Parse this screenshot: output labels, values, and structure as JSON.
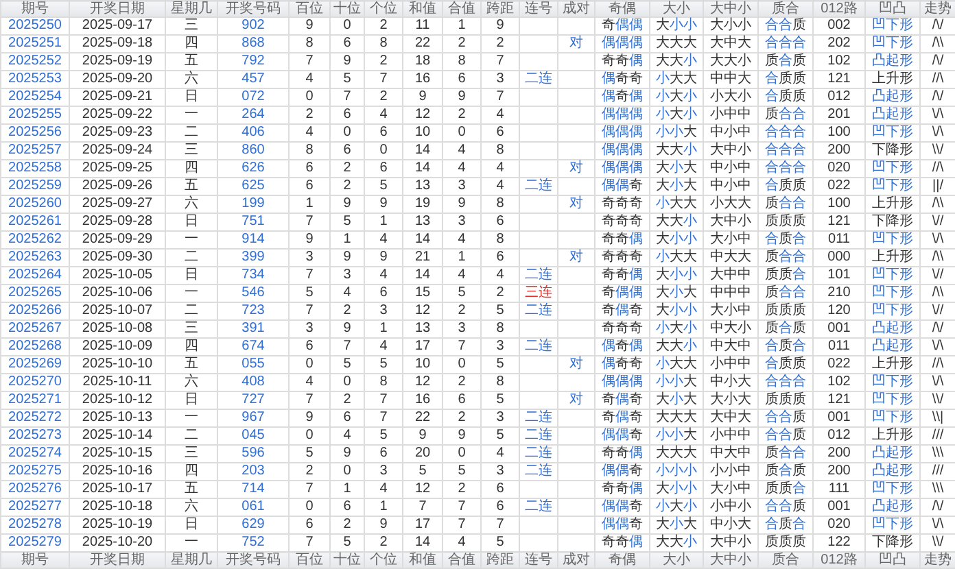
{
  "header": [
    "期号",
    "开奖日期",
    "星期几",
    "开奖号码",
    "百位",
    "十位",
    "个位",
    "和值",
    "合值",
    "跨距",
    "连号",
    "成对",
    "奇偶",
    "大小",
    "大中小",
    "质合",
    "012路",
    "凹凸",
    "走势"
  ],
  "rows": [
    {
      "issue": "2025250",
      "date": "2025-09-17",
      "weekday": "三",
      "number": "902",
      "hundreds": "9",
      "tens": "0",
      "units": "2",
      "sum": "11",
      "sum_tail": "1",
      "span": "9",
      "parity": {
        "text": "奇偶偶",
        "marked": [
          false,
          true,
          true
        ]
      },
      "size": {
        "text": "大小小",
        "marked": [
          false,
          true,
          true
        ]
      },
      "band": "大小小",
      "prime": {
        "text": "合合质",
        "marked": [
          true,
          true,
          false
        ]
      },
      "route": "002",
      "shape": {
        "text": "凹下形",
        "marked": true
      },
      "trend": "/\\/"
    },
    {
      "issue": "2025251",
      "date": "2025-09-18",
      "weekday": "四",
      "number": "868",
      "hundreds": "8",
      "tens": "6",
      "units": "8",
      "sum": "22",
      "sum_tail": "2",
      "span": "2",
      "pair": "对",
      "parity": {
        "text": "偶偶偶",
        "marked": [
          true,
          true,
          true
        ]
      },
      "size": {
        "text": "大大大",
        "marked": [
          false,
          false,
          false
        ]
      },
      "band": "大中大",
      "prime": {
        "text": "合合合",
        "marked": [
          true,
          true,
          true
        ]
      },
      "route": "202",
      "shape": {
        "text": "凹下形",
        "marked": true
      },
      "trend": "/\\\\"
    },
    {
      "issue": "2025252",
      "date": "2025-09-19",
      "weekday": "五",
      "number": "792",
      "hundreds": "7",
      "tens": "9",
      "units": "2",
      "sum": "18",
      "sum_tail": "8",
      "span": "7",
      "parity": {
        "text": "奇奇偶",
        "marked": [
          false,
          false,
          true
        ]
      },
      "size": {
        "text": "大大小",
        "marked": [
          false,
          false,
          true
        ]
      },
      "band": "大大小",
      "prime": {
        "text": "质合质",
        "marked": [
          false,
          true,
          false
        ]
      },
      "route": "102",
      "shape": {
        "text": "凸起形",
        "marked": true
      },
      "trend": "/\\/"
    },
    {
      "issue": "2025253",
      "date": "2025-09-20",
      "weekday": "六",
      "number": "457",
      "hundreds": "4",
      "tens": "5",
      "units": "7",
      "sum": "16",
      "sum_tail": "6",
      "span": "3",
      "consec": {
        "text": "二连",
        "color": "#2f6fd6"
      },
      "parity": {
        "text": "偶奇奇",
        "marked": [
          true,
          false,
          false
        ]
      },
      "size": {
        "text": "小大大",
        "marked": [
          true,
          false,
          false
        ]
      },
      "band": "中中大",
      "prime": {
        "text": "合质质",
        "marked": [
          true,
          false,
          false
        ]
      },
      "route": "121",
      "shape": {
        "text": "上升形",
        "marked": false
      },
      "trend": "//\\"
    },
    {
      "issue": "2025254",
      "date": "2025-09-21",
      "weekday": "日",
      "number": "072",
      "hundreds": "0",
      "tens": "7",
      "units": "2",
      "sum": "9",
      "sum_tail": "9",
      "span": "7",
      "parity": {
        "text": "偶奇偶",
        "marked": [
          true,
          false,
          true
        ]
      },
      "size": {
        "text": "小大小",
        "marked": [
          true,
          false,
          true
        ]
      },
      "band": "小大小",
      "prime": {
        "text": "合质质",
        "marked": [
          true,
          false,
          false
        ]
      },
      "route": "012",
      "shape": {
        "text": "凸起形",
        "marked": true
      },
      "trend": "/\\/"
    },
    {
      "issue": "2025255",
      "date": "2025-09-22",
      "weekday": "一",
      "number": "264",
      "hundreds": "2",
      "tens": "6",
      "units": "4",
      "sum": "12",
      "sum_tail": "2",
      "span": "4",
      "parity": {
        "text": "偶偶偶",
        "marked": [
          true,
          true,
          true
        ]
      },
      "size": {
        "text": "小大小",
        "marked": [
          true,
          false,
          true
        ]
      },
      "band": "小中中",
      "prime": {
        "text": "质合合",
        "marked": [
          false,
          true,
          true
        ]
      },
      "route": "201",
      "shape": {
        "text": "凸起形",
        "marked": true
      },
      "trend": "\\/\\"
    },
    {
      "issue": "2025256",
      "date": "2025-09-23",
      "weekday": "二",
      "number": "406",
      "hundreds": "4",
      "tens": "0",
      "units": "6",
      "sum": "10",
      "sum_tail": "0",
      "span": "6",
      "parity": {
        "text": "偶偶偶",
        "marked": [
          true,
          true,
          true
        ]
      },
      "size": {
        "text": "小小大",
        "marked": [
          true,
          true,
          false
        ]
      },
      "band": "中小中",
      "prime": {
        "text": "合合合",
        "marked": [
          true,
          true,
          true
        ]
      },
      "route": "100",
      "shape": {
        "text": "凹下形",
        "marked": true
      },
      "trend": "\\/\\"
    },
    {
      "issue": "2025257",
      "date": "2025-09-24",
      "weekday": "三",
      "number": "860",
      "hundreds": "8",
      "tens": "6",
      "units": "0",
      "sum": "14",
      "sum_tail": "4",
      "span": "8",
      "parity": {
        "text": "偶偶偶",
        "marked": [
          true,
          true,
          true
        ]
      },
      "size": {
        "text": "大大小",
        "marked": [
          false,
          false,
          true
        ]
      },
      "band": "大中小",
      "prime": {
        "text": "合合合",
        "marked": [
          true,
          true,
          true
        ]
      },
      "route": "200",
      "shape": {
        "text": "下降形",
        "marked": false
      },
      "trend": "\\\\/"
    },
    {
      "issue": "2025258",
      "date": "2025-09-25",
      "weekday": "四",
      "number": "626",
      "hundreds": "6",
      "tens": "2",
      "units": "6",
      "sum": "14",
      "sum_tail": "4",
      "span": "4",
      "pair": "对",
      "parity": {
        "text": "偶偶偶",
        "marked": [
          true,
          true,
          true
        ]
      },
      "size": {
        "text": "大小大",
        "marked": [
          false,
          true,
          false
        ]
      },
      "band": "中小中",
      "prime": {
        "text": "合合合",
        "marked": [
          true,
          true,
          true
        ]
      },
      "route": "020",
      "shape": {
        "text": "凹下形",
        "marked": true
      },
      "trend": "//\\"
    },
    {
      "issue": "2025259",
      "date": "2025-09-26",
      "weekday": "五",
      "number": "625",
      "hundreds": "6",
      "tens": "2",
      "units": "5",
      "sum": "13",
      "sum_tail": "3",
      "span": "4",
      "consec": {
        "text": "二连",
        "color": "#2f6fd6"
      },
      "parity": {
        "text": "偶偶奇",
        "marked": [
          true,
          true,
          false
        ]
      },
      "size": {
        "text": "大小大",
        "marked": [
          false,
          true,
          false
        ]
      },
      "band": "中小中",
      "prime": {
        "text": "合质质",
        "marked": [
          true,
          false,
          false
        ]
      },
      "route": "022",
      "shape": {
        "text": "凹下形",
        "marked": true
      },
      "trend": "||/"
    },
    {
      "issue": "2025260",
      "date": "2025-09-27",
      "weekday": "六",
      "number": "199",
      "hundreds": "1",
      "tens": "9",
      "units": "9",
      "sum": "19",
      "sum_tail": "9",
      "span": "8",
      "pair": "对",
      "parity": {
        "text": "奇奇奇",
        "marked": [
          false,
          false,
          false
        ]
      },
      "size": {
        "text": "小大大",
        "marked": [
          true,
          false,
          false
        ]
      },
      "band": "小大大",
      "prime": {
        "text": "质合合",
        "marked": [
          false,
          true,
          true
        ]
      },
      "route": "100",
      "shape": {
        "text": "上升形",
        "marked": false
      },
      "trend": "/\\\\"
    },
    {
      "issue": "2025261",
      "date": "2025-09-28",
      "weekday": "日",
      "number": "751",
      "hundreds": "7",
      "tens": "5",
      "units": "1",
      "sum": "13",
      "sum_tail": "3",
      "span": "6",
      "parity": {
        "text": "奇奇奇",
        "marked": [
          false,
          false,
          false
        ]
      },
      "size": {
        "text": "大大小",
        "marked": [
          false,
          false,
          true
        ]
      },
      "band": "大中小",
      "prime": {
        "text": "质质质",
        "marked": [
          false,
          false,
          false
        ]
      },
      "route": "121",
      "shape": {
        "text": "下降形",
        "marked": false
      },
      "trend": "\\//"
    },
    {
      "issue": "2025262",
      "date": "2025-09-29",
      "weekday": "一",
      "number": "914",
      "hundreds": "9",
      "tens": "1",
      "units": "4",
      "sum": "14",
      "sum_tail": "4",
      "span": "8",
      "parity": {
        "text": "奇奇偶",
        "marked": [
          false,
          false,
          true
        ]
      },
      "size": {
        "text": "大小小",
        "marked": [
          false,
          true,
          true
        ]
      },
      "band": "大小中",
      "prime": {
        "text": "合质合",
        "marked": [
          true,
          false,
          true
        ]
      },
      "route": "011",
      "shape": {
        "text": "凹下形",
        "marked": true
      },
      "trend": "\\/\\"
    },
    {
      "issue": "2025263",
      "date": "2025-09-30",
      "weekday": "二",
      "number": "399",
      "hundreds": "3",
      "tens": "9",
      "units": "9",
      "sum": "21",
      "sum_tail": "1",
      "span": "6",
      "pair": "对",
      "parity": {
        "text": "奇奇奇",
        "marked": [
          false,
          false,
          false
        ]
      },
      "size": {
        "text": "小大大",
        "marked": [
          true,
          false,
          false
        ]
      },
      "band": "中大大",
      "prime": {
        "text": "质合合",
        "marked": [
          false,
          true,
          true
        ]
      },
      "route": "000",
      "shape": {
        "text": "上升形",
        "marked": false
      },
      "trend": "/\\\\"
    },
    {
      "issue": "2025264",
      "date": "2025-10-05",
      "weekday": "日",
      "number": "734",
      "hundreds": "7",
      "tens": "3",
      "units": "4",
      "sum": "14",
      "sum_tail": "4",
      "span": "4",
      "consec": {
        "text": "二连",
        "color": "#2f6fd6"
      },
      "parity": {
        "text": "奇奇偶",
        "marked": [
          false,
          false,
          true
        ]
      },
      "size": {
        "text": "大小小",
        "marked": [
          false,
          true,
          true
        ]
      },
      "band": "大中中",
      "prime": {
        "text": "质质合",
        "marked": [
          false,
          false,
          true
        ]
      },
      "route": "101",
      "shape": {
        "text": "凹下形",
        "marked": true
      },
      "trend": "\\//"
    },
    {
      "issue": "2025265",
      "date": "2025-10-06",
      "weekday": "一",
      "number": "546",
      "hundreds": "5",
      "tens": "4",
      "units": "6",
      "sum": "15",
      "sum_tail": "5",
      "span": "2",
      "consec": {
        "text": "三连",
        "color": "#e0302a"
      },
      "parity": {
        "text": "奇偶偶",
        "marked": [
          false,
          true,
          true
        ]
      },
      "size": {
        "text": "大小大",
        "marked": [
          false,
          true,
          false
        ]
      },
      "band": "中中中",
      "prime": {
        "text": "质合合",
        "marked": [
          false,
          true,
          true
        ]
      },
      "route": "210",
      "shape": {
        "text": "凹下形",
        "marked": true
      },
      "trend": "/\\\\"
    },
    {
      "issue": "2025266",
      "date": "2025-10-07",
      "weekday": "二",
      "number": "723",
      "hundreds": "7",
      "tens": "2",
      "units": "3",
      "sum": "12",
      "sum_tail": "2",
      "span": "5",
      "consec": {
        "text": "二连",
        "color": "#2f6fd6"
      },
      "parity": {
        "text": "奇偶奇",
        "marked": [
          false,
          true,
          false
        ]
      },
      "size": {
        "text": "大小小",
        "marked": [
          false,
          true,
          true
        ]
      },
      "band": "大小中",
      "prime": {
        "text": "质质质",
        "marked": [
          false,
          false,
          false
        ]
      },
      "route": "120",
      "shape": {
        "text": "凹下形",
        "marked": true
      },
      "trend": "\\//"
    },
    {
      "issue": "2025267",
      "date": "2025-10-08",
      "weekday": "三",
      "number": "391",
      "hundreds": "3",
      "tens": "9",
      "units": "1",
      "sum": "13",
      "sum_tail": "3",
      "span": "8",
      "parity": {
        "text": "奇奇奇",
        "marked": [
          false,
          false,
          false
        ]
      },
      "size": {
        "text": "小大小",
        "marked": [
          true,
          false,
          true
        ]
      },
      "band": "中大小",
      "prime": {
        "text": "质合质",
        "marked": [
          false,
          true,
          false
        ]
      },
      "route": "001",
      "shape": {
        "text": "凸起形",
        "marked": true
      },
      "trend": "/\\/"
    },
    {
      "issue": "2025268",
      "date": "2025-10-09",
      "weekday": "四",
      "number": "674",
      "hundreds": "6",
      "tens": "7",
      "units": "4",
      "sum": "17",
      "sum_tail": "7",
      "span": "3",
      "consec": {
        "text": "二连",
        "color": "#2f6fd6"
      },
      "parity": {
        "text": "偶奇偶",
        "marked": [
          true,
          false,
          true
        ]
      },
      "size": {
        "text": "大大小",
        "marked": [
          false,
          false,
          true
        ]
      },
      "band": "中大中",
      "prime": {
        "text": "合质合",
        "marked": [
          true,
          false,
          true
        ]
      },
      "route": "011",
      "shape": {
        "text": "凸起形",
        "marked": true
      },
      "trend": "\\/\\"
    },
    {
      "issue": "2025269",
      "date": "2025-10-10",
      "weekday": "五",
      "number": "055",
      "hundreds": "0",
      "tens": "5",
      "units": "5",
      "sum": "10",
      "sum_tail": "0",
      "span": "5",
      "pair": "对",
      "parity": {
        "text": "偶奇奇",
        "marked": [
          true,
          false,
          false
        ]
      },
      "size": {
        "text": "小大大",
        "marked": [
          true,
          false,
          false
        ]
      },
      "band": "小中中",
      "prime": {
        "text": "合质质",
        "marked": [
          true,
          false,
          false
        ]
      },
      "route": "022",
      "shape": {
        "text": "上升形",
        "marked": false
      },
      "trend": "//\\"
    },
    {
      "issue": "2025270",
      "date": "2025-10-11",
      "weekday": "六",
      "number": "408",
      "hundreds": "4",
      "tens": "0",
      "units": "8",
      "sum": "12",
      "sum_tail": "2",
      "span": "8",
      "parity": {
        "text": "偶偶偶",
        "marked": [
          true,
          true,
          true
        ]
      },
      "size": {
        "text": "小小大",
        "marked": [
          true,
          true,
          false
        ]
      },
      "band": "中小大",
      "prime": {
        "text": "合合合",
        "marked": [
          true,
          true,
          true
        ]
      },
      "route": "102",
      "shape": {
        "text": "凹下形",
        "marked": true
      },
      "trend": "\\/\\"
    },
    {
      "issue": "2025271",
      "date": "2025-10-12",
      "weekday": "日",
      "number": "727",
      "hundreds": "7",
      "tens": "2",
      "units": "7",
      "sum": "16",
      "sum_tail": "6",
      "span": "5",
      "pair": "对",
      "parity": {
        "text": "奇偶奇",
        "marked": [
          false,
          true,
          false
        ]
      },
      "size": {
        "text": "大小大",
        "marked": [
          false,
          true,
          false
        ]
      },
      "band": "大小大",
      "prime": {
        "text": "质质质",
        "marked": [
          false,
          false,
          false
        ]
      },
      "route": "121",
      "shape": {
        "text": "凹下形",
        "marked": true
      },
      "trend": "\\\\/"
    },
    {
      "issue": "2025272",
      "date": "2025-10-13",
      "weekday": "一",
      "number": "967",
      "hundreds": "9",
      "tens": "6",
      "units": "7",
      "sum": "22",
      "sum_tail": "2",
      "span": "3",
      "consec": {
        "text": "二连",
        "color": "#2f6fd6"
      },
      "parity": {
        "text": "奇偶奇",
        "marked": [
          false,
          true,
          false
        ]
      },
      "size": {
        "text": "大大大",
        "marked": [
          false,
          false,
          false
        ]
      },
      "band": "大中大",
      "prime": {
        "text": "合合质",
        "marked": [
          true,
          true,
          false
        ]
      },
      "route": "001",
      "shape": {
        "text": "凹下形",
        "marked": true
      },
      "trend": "\\\\|"
    },
    {
      "issue": "2025273",
      "date": "2025-10-14",
      "weekday": "二",
      "number": "045",
      "hundreds": "0",
      "tens": "4",
      "units": "5",
      "sum": "9",
      "sum_tail": "9",
      "span": "5",
      "consec": {
        "text": "二连",
        "color": "#2f6fd6"
      },
      "parity": {
        "text": "偶偶奇",
        "marked": [
          true,
          true,
          false
        ]
      },
      "size": {
        "text": "小小大",
        "marked": [
          true,
          true,
          false
        ]
      },
      "band": "小中中",
      "prime": {
        "text": "合合质",
        "marked": [
          true,
          true,
          false
        ]
      },
      "route": "012",
      "shape": {
        "text": "上升形",
        "marked": false
      },
      "trend": "///"
    },
    {
      "issue": "2025274",
      "date": "2025-10-15",
      "weekday": "三",
      "number": "596",
      "hundreds": "5",
      "tens": "9",
      "units": "6",
      "sum": "20",
      "sum_tail": "0",
      "span": "4",
      "consec": {
        "text": "二连",
        "color": "#2f6fd6"
      },
      "parity": {
        "text": "奇奇偶",
        "marked": [
          false,
          false,
          true
        ]
      },
      "size": {
        "text": "大大大",
        "marked": [
          false,
          false,
          false
        ]
      },
      "band": "中大中",
      "prime": {
        "text": "质合合",
        "marked": [
          false,
          true,
          true
        ]
      },
      "route": "200",
      "shape": {
        "text": "凸起形",
        "marked": true
      },
      "trend": "\\\\\\"
    },
    {
      "issue": "2025275",
      "date": "2025-10-16",
      "weekday": "四",
      "number": "203",
      "hundreds": "2",
      "tens": "0",
      "units": "3",
      "sum": "5",
      "sum_tail": "5",
      "span": "3",
      "consec": {
        "text": "二连",
        "color": "#2f6fd6"
      },
      "parity": {
        "text": "偶偶奇",
        "marked": [
          true,
          true,
          false
        ]
      },
      "size": {
        "text": "小小小",
        "marked": [
          true,
          true,
          true
        ]
      },
      "band": "小小中",
      "prime": {
        "text": "质合质",
        "marked": [
          false,
          true,
          false
        ]
      },
      "route": "200",
      "shape": {
        "text": "凸起形",
        "marked": true
      },
      "trend": "///"
    },
    {
      "issue": "2025276",
      "date": "2025-10-17",
      "weekday": "五",
      "number": "714",
      "hundreds": "7",
      "tens": "1",
      "units": "4",
      "sum": "12",
      "sum_tail": "2",
      "span": "6",
      "parity": {
        "text": "奇奇偶",
        "marked": [
          false,
          false,
          true
        ]
      },
      "size": {
        "text": "大小小",
        "marked": [
          false,
          true,
          true
        ]
      },
      "band": "大小中",
      "prime": {
        "text": "质质合",
        "marked": [
          false,
          false,
          true
        ]
      },
      "route": "111",
      "shape": {
        "text": "凹下形",
        "marked": true
      },
      "trend": "\\\\\\"
    },
    {
      "issue": "2025277",
      "date": "2025-10-18",
      "weekday": "六",
      "number": "061",
      "hundreds": "0",
      "tens": "6",
      "units": "1",
      "sum": "7",
      "sum_tail": "7",
      "span": "6",
      "consec": {
        "text": "二连",
        "color": "#2f6fd6"
      },
      "parity": {
        "text": "偶偶奇",
        "marked": [
          true,
          true,
          false
        ]
      },
      "size": {
        "text": "小大小",
        "marked": [
          true,
          false,
          true
        ]
      },
      "band": "小中小",
      "prime": {
        "text": "合合质",
        "marked": [
          true,
          true,
          false
        ]
      },
      "route": "001",
      "shape": {
        "text": "凸起形",
        "marked": true
      },
      "trend": "/\\/"
    },
    {
      "issue": "2025278",
      "date": "2025-10-19",
      "weekday": "日",
      "number": "629",
      "hundreds": "6",
      "tens": "2",
      "units": "9",
      "sum": "17",
      "sum_tail": "7",
      "span": "7",
      "parity": {
        "text": "偶偶奇",
        "marked": [
          true,
          true,
          false
        ]
      },
      "size": {
        "text": "大小大",
        "marked": [
          false,
          true,
          false
        ]
      },
      "band": "中小大",
      "prime": {
        "text": "合质合",
        "marked": [
          true,
          false,
          true
        ]
      },
      "route": "020",
      "shape": {
        "text": "凹下形",
        "marked": true
      },
      "trend": "\\/\\"
    },
    {
      "issue": "2025279",
      "date": "2025-10-20",
      "weekday": "一",
      "number": "752",
      "hundreds": "7",
      "tens": "5",
      "units": "2",
      "sum": "14",
      "sum_tail": "4",
      "span": "5",
      "parity": {
        "text": "奇奇偶",
        "marked": [
          false,
          false,
          true
        ]
      },
      "size": {
        "text": "大大小",
        "marked": [
          false,
          false,
          true
        ]
      },
      "band": "大中小",
      "prime": {
        "text": "质质质",
        "marked": [
          false,
          false,
          false
        ]
      },
      "route": "122",
      "shape": {
        "text": "下降形",
        "marked": false
      },
      "trend": "\\\\/"
    }
  ],
  "footer": [
    "期号",
    "开奖日期",
    "星期几",
    "开奖号码",
    "百位",
    "十位",
    "个位",
    "和值",
    "合值",
    "跨距",
    "连号",
    "成对",
    "奇偶",
    "大小",
    "大中小",
    "质合",
    "012路",
    "凹凸",
    "走势"
  ]
}
